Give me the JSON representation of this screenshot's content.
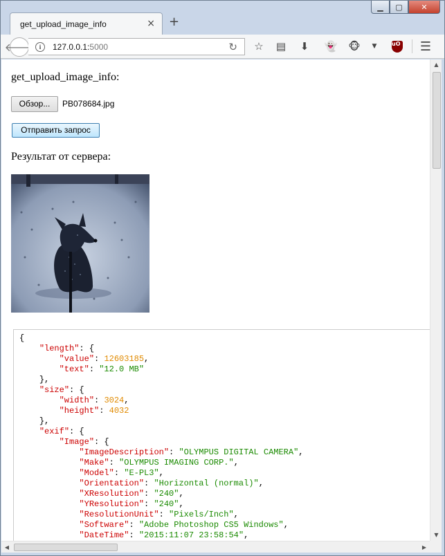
{
  "browser": {
    "tab_title": "get_upload_image_info",
    "tab_close_icon": "×",
    "new_tab_icon": "+",
    "url_host": "127.0.0.1:",
    "url_port": "5000",
    "info_icon": "i"
  },
  "page": {
    "heading": "get_upload_image_info:",
    "file_button_label": "Обзор...",
    "file_name": "PB078684.jpg",
    "submit_label": "Отправить запрос",
    "result_label": "Результат от сервера:"
  },
  "json_lines": [
    {
      "indent": 0,
      "parts": [
        [
          "p",
          "{"
        ]
      ]
    },
    {
      "indent": 1,
      "parts": [
        [
          "k",
          "\"length\""
        ],
        [
          "p",
          ": {"
        ]
      ]
    },
    {
      "indent": 2,
      "parts": [
        [
          "k",
          "\"value\""
        ],
        [
          "p",
          ": "
        ],
        [
          "n",
          "12603185"
        ],
        [
          "p",
          ","
        ]
      ]
    },
    {
      "indent": 2,
      "parts": [
        [
          "k",
          "\"text\""
        ],
        [
          "p",
          ": "
        ],
        [
          "s",
          "\"12.0 MB\""
        ]
      ]
    },
    {
      "indent": 1,
      "parts": [
        [
          "p",
          "},"
        ]
      ]
    },
    {
      "indent": 1,
      "parts": [
        [
          "k",
          "\"size\""
        ],
        [
          "p",
          ": {"
        ]
      ]
    },
    {
      "indent": 2,
      "parts": [
        [
          "k",
          "\"width\""
        ],
        [
          "p",
          ": "
        ],
        [
          "n",
          "3024"
        ],
        [
          "p",
          ","
        ]
      ]
    },
    {
      "indent": 2,
      "parts": [
        [
          "k",
          "\"height\""
        ],
        [
          "p",
          ": "
        ],
        [
          "n",
          "4032"
        ]
      ]
    },
    {
      "indent": 1,
      "parts": [
        [
          "p",
          "},"
        ]
      ]
    },
    {
      "indent": 1,
      "parts": [
        [
          "k",
          "\"exif\""
        ],
        [
          "p",
          ": {"
        ]
      ]
    },
    {
      "indent": 2,
      "parts": [
        [
          "k",
          "\"Image\""
        ],
        [
          "p",
          ": {"
        ]
      ]
    },
    {
      "indent": 3,
      "parts": [
        [
          "k",
          "\"ImageDescription\""
        ],
        [
          "p",
          ": "
        ],
        [
          "s",
          "\"OLYMPUS DIGITAL CAMERA\""
        ],
        [
          "p",
          ","
        ]
      ]
    },
    {
      "indent": 3,
      "parts": [
        [
          "k",
          "\"Make\""
        ],
        [
          "p",
          ": "
        ],
        [
          "s",
          "\"OLYMPUS IMAGING CORP.\""
        ],
        [
          "p",
          ","
        ]
      ]
    },
    {
      "indent": 3,
      "parts": [
        [
          "k",
          "\"Model\""
        ],
        [
          "p",
          ": "
        ],
        [
          "s",
          "\"E-PL3\""
        ],
        [
          "p",
          ","
        ]
      ]
    },
    {
      "indent": 3,
      "parts": [
        [
          "k",
          "\"Orientation\""
        ],
        [
          "p",
          ": "
        ],
        [
          "s",
          "\"Horizontal (normal)\""
        ],
        [
          "p",
          ","
        ]
      ]
    },
    {
      "indent": 3,
      "parts": [
        [
          "k",
          "\"XResolution\""
        ],
        [
          "p",
          ": "
        ],
        [
          "s",
          "\"240\""
        ],
        [
          "p",
          ","
        ]
      ]
    },
    {
      "indent": 3,
      "parts": [
        [
          "k",
          "\"YResolution\""
        ],
        [
          "p",
          ": "
        ],
        [
          "s",
          "\"240\""
        ],
        [
          "p",
          ","
        ]
      ]
    },
    {
      "indent": 3,
      "parts": [
        [
          "k",
          "\"ResolutionUnit\""
        ],
        [
          "p",
          ": "
        ],
        [
          "s",
          "\"Pixels/Inch\""
        ],
        [
          "p",
          ","
        ]
      ]
    },
    {
      "indent": 3,
      "parts": [
        [
          "k",
          "\"Software\""
        ],
        [
          "p",
          ": "
        ],
        [
          "s",
          "\"Adobe Photoshop CS5 Windows\""
        ],
        [
          "p",
          ","
        ]
      ]
    },
    {
      "indent": 3,
      "parts": [
        [
          "k",
          "\"DateTime\""
        ],
        [
          "p",
          ": "
        ],
        [
          "s",
          "\"2015:11:07 23:58:54\""
        ],
        [
          "p",
          ","
        ]
      ]
    }
  ],
  "colors": {
    "json_key": "#cc0000",
    "json_number": "#e08a00",
    "json_string": "#1a8a00",
    "ublock_red": "#880000"
  }
}
